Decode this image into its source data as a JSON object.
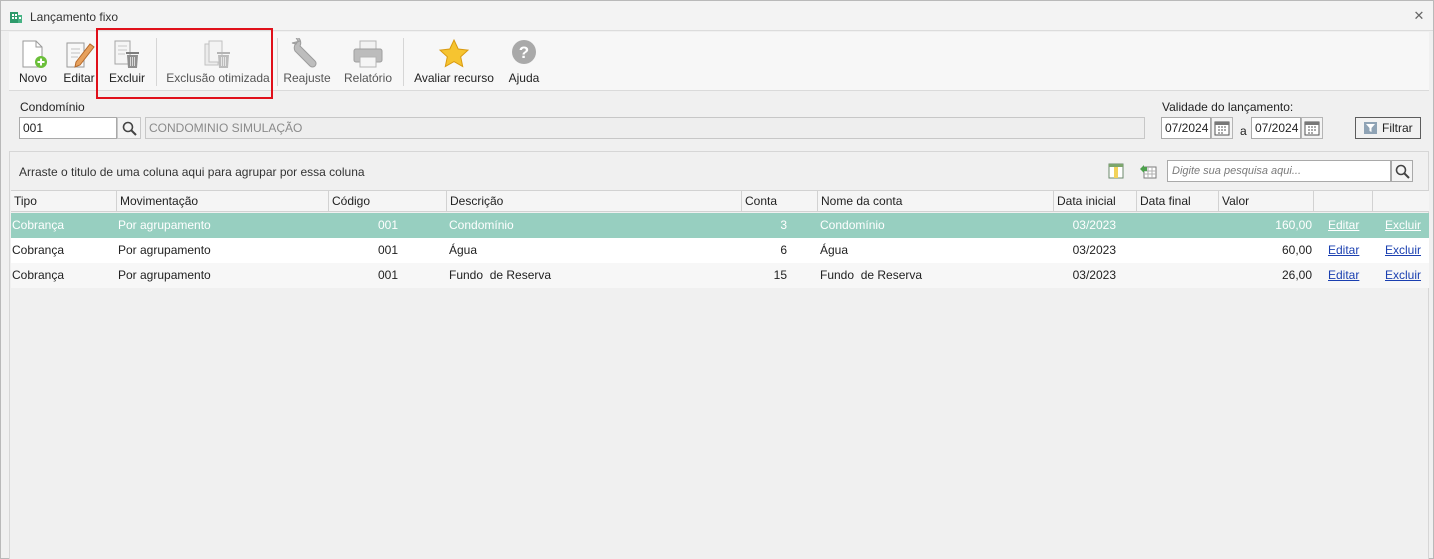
{
  "window": {
    "title": "Lançamento fixo",
    "close_glyph": "✕"
  },
  "toolbar": {
    "buttons": [
      {
        "label": "Novo",
        "icon": "new-document-icon"
      },
      {
        "label": "Editar",
        "icon": "edit-pencil-icon"
      },
      {
        "label": "Excluir",
        "icon": "delete-document-icon"
      },
      {
        "label": "Exclusão otimizada",
        "icon": "optimized-delete-icon"
      },
      {
        "label": "Reajuste",
        "icon": "wrench-icon"
      },
      {
        "label": "Relatório",
        "icon": "printer-icon"
      },
      {
        "label": "Avaliar recurso",
        "icon": "star-icon"
      },
      {
        "label": "Ajuda",
        "icon": "help-icon"
      }
    ]
  },
  "filters": {
    "condominio_label": "Condomínio",
    "condominio_code": "001",
    "condominio_name": "CONDOMINIO SIMULAÇÃO",
    "validade_label": "Validade do lançamento:",
    "date_from": "07/2024",
    "date_sep": "a",
    "date_to": "07/2024",
    "filter_button": "Filtrar"
  },
  "grid": {
    "group_hint": "Arraste o titulo de uma coluna aqui para agrupar por essa coluna",
    "search_placeholder": "Digite sua pesquisa aqui...",
    "columns": [
      "Tipo",
      "Movimentação",
      "Código",
      "Descrição",
      "Conta",
      "Nome da conta",
      "Data inicial",
      "Data final",
      "Valor",
      "",
      ""
    ],
    "rows": [
      {
        "tipo": "Cobrança",
        "movimentacao": "Por agrupamento",
        "codigo": "001",
        "descricao": "Condomínio",
        "conta": "3",
        "nome_conta": "Condomínio",
        "data_inicial": "03/2023",
        "data_final": "",
        "valor": "160,00",
        "editar": "Editar",
        "excluir": "Excluir",
        "selected": true
      },
      {
        "tipo": "Cobrança",
        "movimentacao": "Por agrupamento",
        "codigo": "001",
        "descricao": "Água",
        "conta": "6",
        "nome_conta": "Água",
        "data_inicial": "03/2023",
        "data_final": "",
        "valor": "60,00",
        "editar": "Editar",
        "excluir": "Excluir",
        "selected": false
      },
      {
        "tipo": "Cobrança",
        "movimentacao": "Por agrupamento",
        "codigo": "001",
        "descricao": "Fundo  de Reserva",
        "conta": "15",
        "nome_conta": "Fundo  de Reserva",
        "data_inicial": "03/2023",
        "data_final": "",
        "valor": "26,00",
        "editar": "Editar",
        "excluir": "Excluir",
        "selected": false
      }
    ]
  },
  "colors": {
    "selected_row": "#97cfc0",
    "highlight_box": "#e0101a",
    "link": "#1a3fb0"
  }
}
